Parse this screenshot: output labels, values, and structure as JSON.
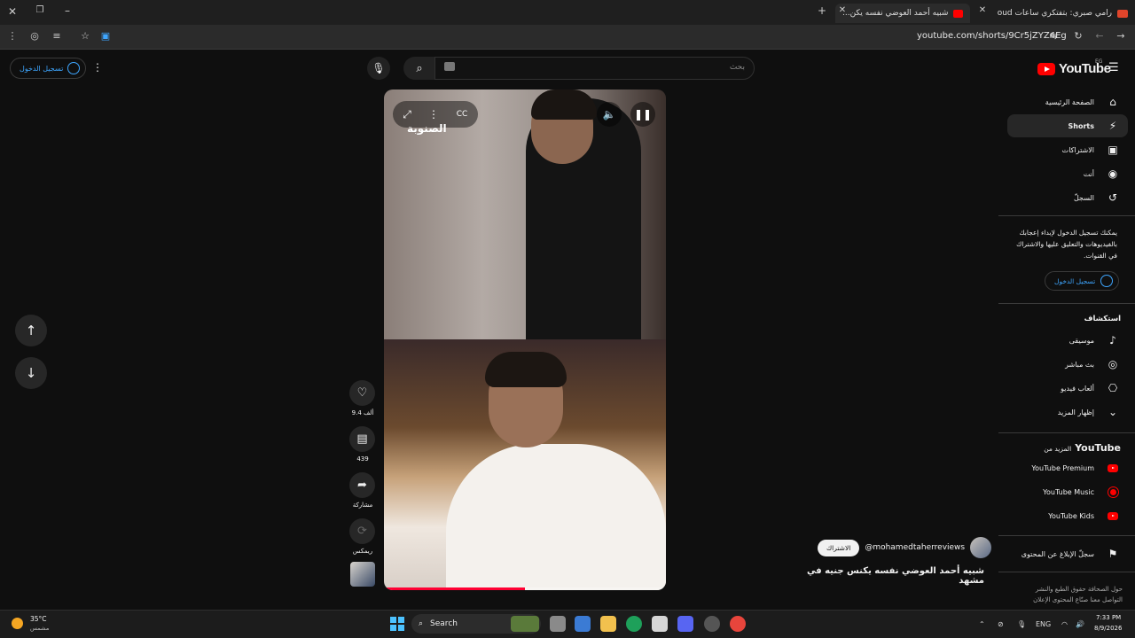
{
  "browser": {
    "tabs": [
      {
        "title": "شبيه أحمد العوضي نفسه يكن...",
        "active": true
      },
      {
        "title": "رامي صبري: بتفتكري ساعات oud",
        "active": false
      }
    ],
    "url": "youtube.com/shorts/9Cr5jZYZ4Eg"
  },
  "header": {
    "logo_text": "YouTube",
    "region": "EG",
    "search_placeholder": "بحث",
    "signin_label": "تسجيل الدخول"
  },
  "sidebar": {
    "items": [
      {
        "label": "الصفحة الرئيسية",
        "icon": "home-icon",
        "glyph": "⌂"
      },
      {
        "label": "Shorts",
        "icon": "shorts-icon",
        "glyph": "⚡",
        "active": true
      },
      {
        "label": "الاشتراكات",
        "icon": "subscriptions-icon",
        "glyph": "▣"
      },
      {
        "label": "أنت",
        "icon": "you-icon",
        "glyph": "◉"
      },
      {
        "label": "السجلّ",
        "icon": "history-icon",
        "glyph": "↺"
      }
    ],
    "signin_prompt": "يمكنك تسجيل الدخول لإبداء إعجابك بالفيديوهات والتعليق عليها والاشتراك في القنوات.",
    "signin_button": "تسجيل الدخول",
    "explore_heading": "استكشاف",
    "explore": [
      {
        "label": "موسيقى",
        "icon": "music-icon",
        "glyph": "♪"
      },
      {
        "label": "بث مباشر",
        "icon": "live-icon",
        "glyph": "◎"
      },
      {
        "label": "ألعاب فيديو",
        "icon": "gaming-icon",
        "glyph": "⎔"
      },
      {
        "label": "إظهار المزيد",
        "icon": "chevron-down-icon",
        "glyph": "⌄"
      }
    ],
    "more_heading_prefix": "المزيد من",
    "more_heading_brand": "YouTube",
    "more": [
      {
        "label": "YouTube Premium",
        "icon": "youtube-premium-icon"
      },
      {
        "label": "YouTube Music",
        "icon": "youtube-music-icon"
      },
      {
        "label": "YouTube Kids",
        "icon": "youtube-kids-icon"
      }
    ],
    "report": "سجلّ الإبلاغ عن المحتوى",
    "footer_line1": "حول  الصحافة  حقوق الطبع والنشر",
    "footer_line2": "التواصل معنا  صنّاع المحتوى  الإعلان"
  },
  "short": {
    "like_count": "9.4 ألف",
    "comment_count": "439",
    "share_label": "مشاركة",
    "remix_label": "ريمكس",
    "channel": "@mohamedtaherreviews",
    "subscribe_label": "الاشتراك",
    "title": "شبيه أحمد العوضي نفسه يكنس جنيه في مشهد",
    "watermark": "الصنوبة",
    "progress": 0.5
  },
  "taskbar": {
    "weather_temp": "35°C",
    "weather_desc": "مشمس",
    "search_label": "Search",
    "lang": "ENG",
    "time": "7:33 PM",
    "date": "8/9/2026"
  }
}
